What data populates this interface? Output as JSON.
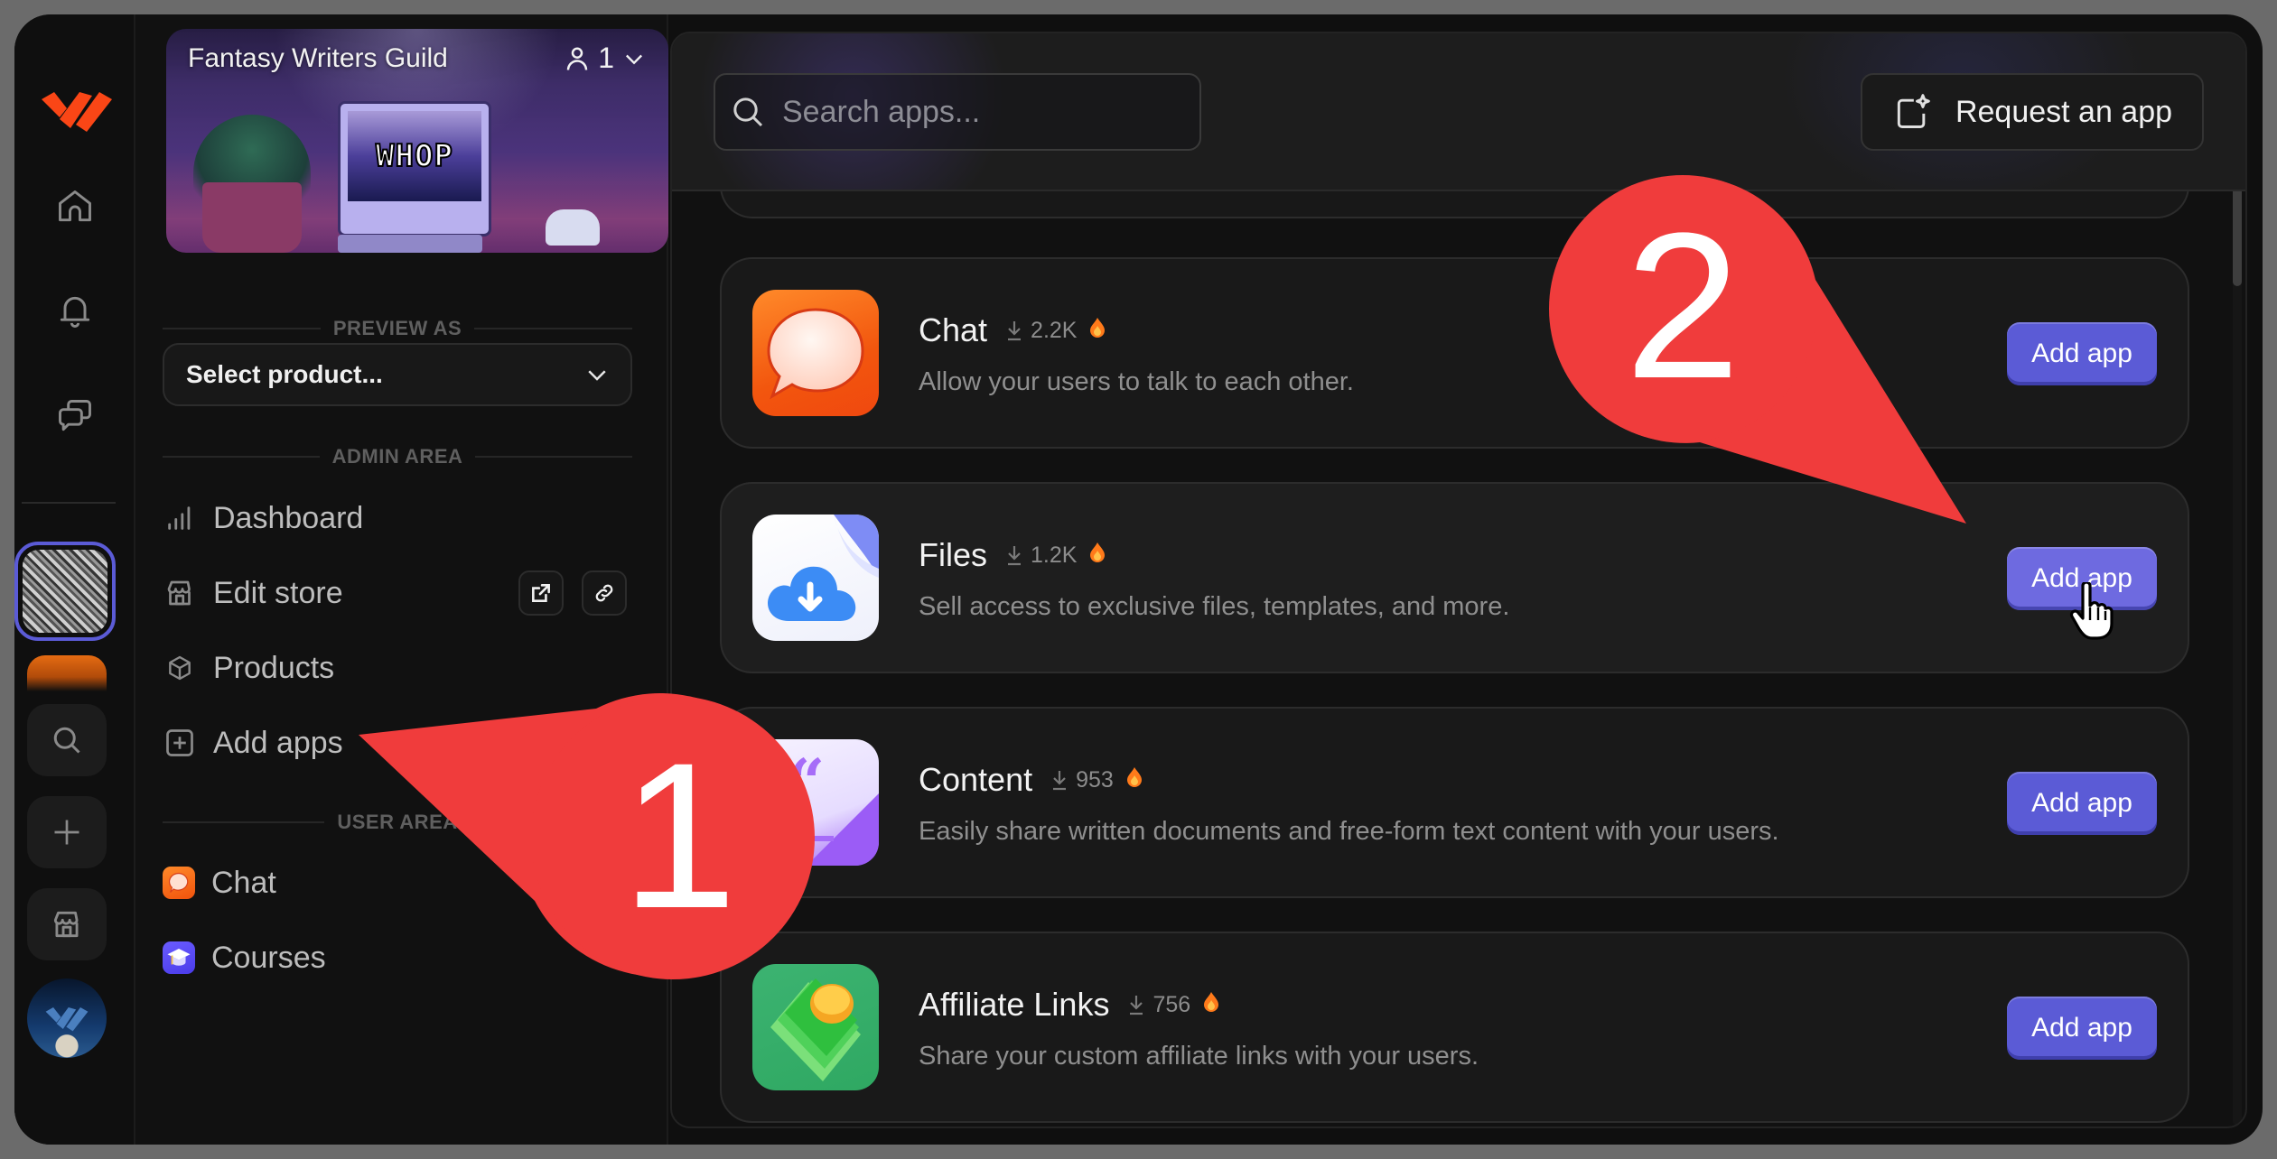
{
  "community": {
    "name": "Fantasy Writers Guild",
    "member_count": "1",
    "banner_screen_text": "WHOP"
  },
  "rail": {
    "items": [
      {
        "name": "home",
        "icon": "home-icon"
      },
      {
        "name": "notifications",
        "icon": "bell-icon"
      },
      {
        "name": "messages",
        "icon": "chat-bubbles-icon"
      }
    ],
    "actions": [
      {
        "name": "search",
        "icon": "search-icon"
      },
      {
        "name": "add",
        "icon": "plus-icon"
      },
      {
        "name": "store",
        "icon": "store-icon"
      }
    ]
  },
  "sidebar": {
    "preview_label": "PREVIEW AS",
    "select_placeholder": "Select product...",
    "admin_label": "ADMIN AREA",
    "admin_items": [
      {
        "label": "Dashboard",
        "icon": "bar-chart-icon"
      },
      {
        "label": "Edit store",
        "icon": "store-icon"
      },
      {
        "label": "Products",
        "icon": "box-icon"
      },
      {
        "label": "Add apps",
        "icon": "plus-square-icon"
      }
    ],
    "user_label": "USER AREA",
    "user_items": [
      {
        "label": "Chat",
        "icon": "chat-app-icon"
      },
      {
        "label": "Courses",
        "icon": "courses-app-icon"
      }
    ]
  },
  "main": {
    "search_placeholder": "Search apps...",
    "request_label": "Request an app",
    "apps": [
      {
        "name": "Chat",
        "downloads": "2.2K",
        "description": "Allow your users to talk to each other.",
        "button": "Add app",
        "trending": true
      },
      {
        "name": "Files",
        "downloads": "1.2K",
        "description": "Sell access to exclusive files, templates, and more.",
        "button": "Add app",
        "trending": true
      },
      {
        "name": "Content",
        "downloads": "953",
        "description": "Easily share written documents and free-form text content with your users.",
        "button": "Add app",
        "trending": true
      },
      {
        "name": "Affiliate Links",
        "downloads": "756",
        "description": "Share your custom affiliate links with your users.",
        "button": "Add app",
        "trending": true
      }
    ]
  },
  "annotations": [
    {
      "number": "1",
      "target": "Add apps"
    },
    {
      "number": "2",
      "target": "Files Add app button"
    }
  ],
  "colors": {
    "accent": "#5b5bd6",
    "callout": "#f03c3c",
    "brand": "#fa4616",
    "trending": "#ff7a1a"
  }
}
